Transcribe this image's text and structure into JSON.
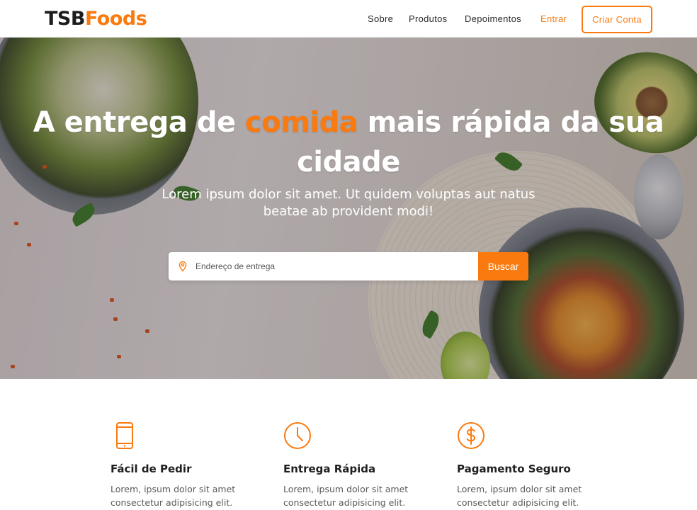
{
  "brand": {
    "part1": "TSB",
    "part2": "Foods",
    "accent_color": "#fb7a0f"
  },
  "nav": {
    "links": [
      "Sobre",
      "Produtos",
      "Depoimentos"
    ],
    "login": "Entrar",
    "signup": "Criar Conta"
  },
  "hero": {
    "title_before": "A entrega de ",
    "title_highlight": "comida",
    "title_after": " mais rápida da sua cidade",
    "subtitle": "Lorem ipsum dolor sit amet. Ut quidem voluptas aut natus beatae ab provident modi!",
    "search": {
      "placeholder": "Endereço de entrega",
      "button": "Buscar",
      "icon": "map-pin-icon"
    }
  },
  "features": [
    {
      "icon": "smartphone-icon",
      "title": "Fácil de Pedir",
      "text": "Lorem, ipsum dolor sit amet consectetur adipisicing elit."
    },
    {
      "icon": "clock-icon",
      "title": "Entrega Rápida",
      "text": "Lorem, ipsum dolor sit amet consectetur adipisicing elit."
    },
    {
      "icon": "dollar-icon",
      "title": "Pagamento Seguro",
      "text": "Lorem, ipsum dolor sit amet consectetur adipisicing elit."
    }
  ]
}
